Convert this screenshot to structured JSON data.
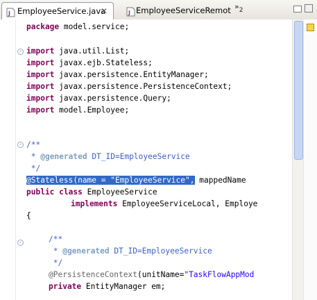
{
  "tabs": [
    {
      "label": "EmployeeService.java",
      "icon": "java-file-icon",
      "active": true
    },
    {
      "label": "EmployeeServiceRemot",
      "icon": "interface-file-icon",
      "active": false
    }
  ],
  "tab_close_glyph": "✕",
  "overflow": {
    "glyph": "»",
    "count": "2"
  },
  "code": {
    "l1": {
      "kw": "package",
      "rest": " model.service;"
    },
    "l2": {
      "kw": "import",
      "rest": " java.util.List;"
    },
    "l3": {
      "kw": "import",
      "rest": " javax.ejb.Stateless;"
    },
    "l4": {
      "kw": "import",
      "rest": " javax.persistence.EntityManager;"
    },
    "l5": {
      "kw": "import",
      "rest": " javax.persistence.PersistenceContext;"
    },
    "l6": {
      "kw": "import",
      "rest": " javax.persistence.Query;"
    },
    "l7": {
      "kw": "import",
      "rest": " model.Employee;"
    },
    "l8": {
      "text": "/**"
    },
    "l9": {
      "pre": " * ",
      "tag": "@generated",
      "rest": " DT_ID=EmployeeService"
    },
    "l10": {
      "text": " */"
    },
    "l11": {
      "sel_an": "@Stateless(name = ",
      "sel_str": "\"EmployeeService\"",
      "sel_end": ",",
      "rest": " mappedName"
    },
    "l12": {
      "kw1": "public",
      "kw2": "class",
      "rest": " EmployeeService"
    },
    "l13": {
      "kw": "implements",
      "rest": " EmployeeServiceLocal, Employe"
    },
    "l14": {
      "text": "{"
    },
    "l15": {
      "text": "/**"
    },
    "l16": {
      "pre": " * ",
      "tag": "@generated",
      "rest": " DT_ID=EmployeeService"
    },
    "l17": {
      "text": " */"
    },
    "l18": {
      "an": "@PersistenceContext",
      "paren": "(unitName=",
      "str": "\"TaskFlowAppMod"
    },
    "l19": {
      "kw": "private",
      "rest": " EntityManager em;"
    }
  },
  "colors": {
    "keyword": "#7f0055",
    "comment": "#3f5fbf",
    "string": "#2a00ff",
    "annotation": "#646464",
    "selection": "#3169c6"
  }
}
